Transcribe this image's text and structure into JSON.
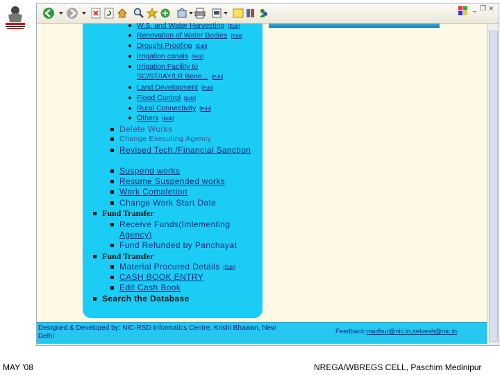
{
  "window_controls": {
    "minimize": "_",
    "restore": "❐",
    "close": "×"
  },
  "toolbar": {
    "icons": [
      "back-icon",
      "forward-icon",
      "stop-icon",
      "refresh-icon",
      "home-icon",
      "search-icon",
      "favorites-icon",
      "media-icon",
      "history-icon",
      "mail-icon",
      "print-icon",
      "edit-icon",
      "discuss-icon",
      "research-icon",
      "messenger-icon"
    ]
  },
  "menu": {
    "subworks": [
      {
        "label": "W.S. and Water Harvesting",
        "edit": "[Edit]"
      },
      {
        "label": "Renovation of Water Bodies",
        "edit": "[Edit]"
      },
      {
        "label": "Drought Proofing",
        "edit": "[Edit]"
      },
      {
        "label": "Irrigation canals",
        "edit": "[Edit]"
      },
      {
        "label": "Irrigation Facility to",
        "edit": ""
      },
      {
        "label": "SC/ST/IAY/LR Bene...",
        "edit": "[Edit]"
      },
      {
        "label": "Land Development",
        "edit": "[Edit]"
      },
      {
        "label": "Flood Control",
        "edit": "[Edit]"
      },
      {
        "label": "Rural Connectivity",
        "edit": "[Edit]"
      },
      {
        "label": "Others",
        "edit": "[Edit]"
      }
    ],
    "delete_works": "Delete Works",
    "change_agency": "Change Executing Agency",
    "revised_sanction": "Revised Tech./Financial Sanction",
    "suspend_works": "Suspend works",
    "resume_works": "Resume Suspended works",
    "work_completion": "Work Completion",
    "change_start": "Change Work Start Date",
    "fund_transfer_1": "Fund Transfer",
    "receive_funds_1": "Receive Funds(Imlementing",
    "receive_funds_2": "Agency)",
    "fund_refunded": "Fund Refunded by Panchayat",
    "fund_transfer_2": "Fund Transfer",
    "material_procured": "Material Procured Details",
    "material_edit": "[Edit]",
    "cash_book_entry": "CASH BOOK ENTRY",
    "edit_cash_book": "Edit Cash Book",
    "search_db": "Search the Database"
  },
  "footer": {
    "designed_by_1": "Designed & Developed by: NIC-RSD Informatics Centre, Krishi Bhawan, New",
    "designed_by_2": "Delhi",
    "feedback_label": "Feedback:",
    "feedback_emails": "madhur@nic.in,selvesh@nic.in"
  },
  "slide": {
    "date": "MAY '08",
    "cell": "NREGA/WBREGS CELL, Paschim Medinipur"
  }
}
